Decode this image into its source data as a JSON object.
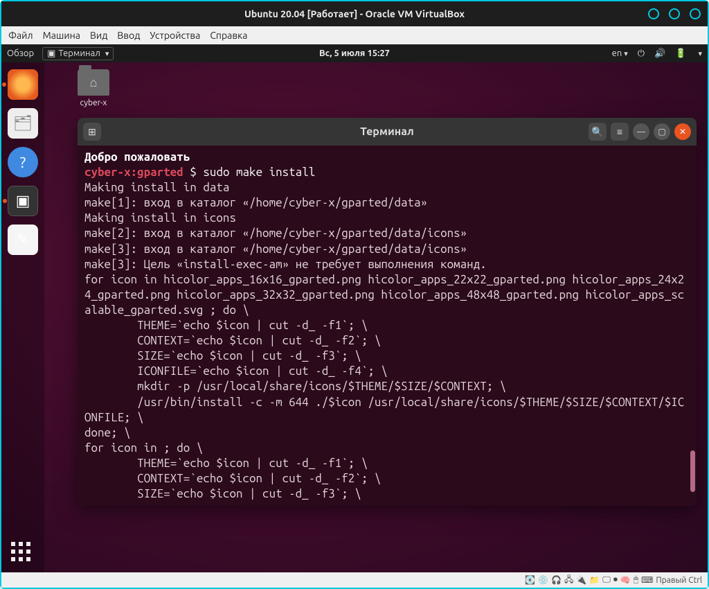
{
  "vbox": {
    "title": "Ubuntu 20.04 [Работает] - Oracle VM VirtualBox",
    "menu": [
      "Файл",
      "Машина",
      "Вид",
      "Ввод",
      "Устройства",
      "Справка"
    ],
    "status_host_key": "Правый Ctrl"
  },
  "ubuntu_topbar": {
    "overview": "Обзор",
    "app_indicator": "Терминал",
    "clock": "Вс, 5 июля  15:27",
    "lang": "en"
  },
  "desktop": {
    "home_folder_label": "cyber-x"
  },
  "terminal": {
    "title": "Терминал",
    "welcome": "Добро пожаловать",
    "prompt_user": "cyber-x:gparted",
    "prompt_symbol": "$",
    "command": "sudo make install",
    "output": "Making install in data\nmake[1]: вход в каталог «/home/cyber-x/gparted/data»\nMaking install in icons\nmake[2]: вход в каталог «/home/cyber-x/gparted/data/icons»\nmake[3]: вход в каталог «/home/cyber-x/gparted/data/icons»\nmake[3]: Цель «install-exec-am» не требует выполнения команд.\nfor icon in hicolor_apps_16x16_gparted.png hicolor_apps_22x22_gparted.png hicolor_apps_24x24_gparted.png hicolor_apps_32x32_gparted.png hicolor_apps_48x48_gparted.png hicolor_apps_scalable_gparted.svg ; do \\\n        THEME=`echo $icon | cut -d_ -f1`; \\\n        CONTEXT=`echo $icon | cut -d_ -f2`; \\\n        SIZE=`echo $icon | cut -d_ -f3`; \\\n        ICONFILE=`echo $icon | cut -d_ -f4`; \\\n        mkdir -p /usr/local/share/icons/$THEME/$SIZE/$CONTEXT; \\\n        /usr/bin/install -c -m 644 ./$icon /usr/local/share/icons/$THEME/$SIZE/$CONTEXT/$ICONFILE; \\\ndone; \\\nfor icon in ; do \\\n        THEME=`echo $icon | cut -d_ -f1`; \\\n        CONTEXT=`echo $icon | cut -d_ -f2`; \\\n        SIZE=`echo $icon | cut -d_ -f3`; \\"
  }
}
